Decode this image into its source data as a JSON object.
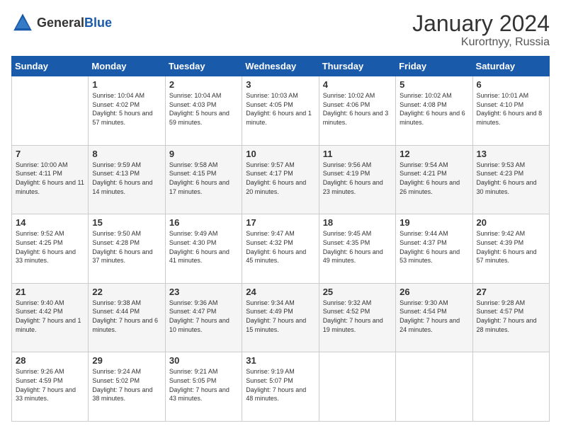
{
  "header": {
    "logo_general": "General",
    "logo_blue": "Blue",
    "month": "January 2024",
    "location": "Kurortnyy, Russia"
  },
  "weekdays": [
    "Sunday",
    "Monday",
    "Tuesday",
    "Wednesday",
    "Thursday",
    "Friday",
    "Saturday"
  ],
  "weeks": [
    [
      {
        "day": "",
        "sunrise": "",
        "sunset": "",
        "daylight": ""
      },
      {
        "day": "1",
        "sunrise": "Sunrise: 10:04 AM",
        "sunset": "Sunset: 4:02 PM",
        "daylight": "Daylight: 5 hours and 57 minutes."
      },
      {
        "day": "2",
        "sunrise": "Sunrise: 10:04 AM",
        "sunset": "Sunset: 4:03 PM",
        "daylight": "Daylight: 5 hours and 59 minutes."
      },
      {
        "day": "3",
        "sunrise": "Sunrise: 10:03 AM",
        "sunset": "Sunset: 4:05 PM",
        "daylight": "Daylight: 6 hours and 1 minute."
      },
      {
        "day": "4",
        "sunrise": "Sunrise: 10:02 AM",
        "sunset": "Sunset: 4:06 PM",
        "daylight": "Daylight: 6 hours and 3 minutes."
      },
      {
        "day": "5",
        "sunrise": "Sunrise: 10:02 AM",
        "sunset": "Sunset: 4:08 PM",
        "daylight": "Daylight: 6 hours and 6 minutes."
      },
      {
        "day": "6",
        "sunrise": "Sunrise: 10:01 AM",
        "sunset": "Sunset: 4:10 PM",
        "daylight": "Daylight: 6 hours and 8 minutes."
      }
    ],
    [
      {
        "day": "7",
        "sunrise": "Sunrise: 10:00 AM",
        "sunset": "Sunset: 4:11 PM",
        "daylight": "Daylight: 6 hours and 11 minutes."
      },
      {
        "day": "8",
        "sunrise": "Sunrise: 9:59 AM",
        "sunset": "Sunset: 4:13 PM",
        "daylight": "Daylight: 6 hours and 14 minutes."
      },
      {
        "day": "9",
        "sunrise": "Sunrise: 9:58 AM",
        "sunset": "Sunset: 4:15 PM",
        "daylight": "Daylight: 6 hours and 17 minutes."
      },
      {
        "day": "10",
        "sunrise": "Sunrise: 9:57 AM",
        "sunset": "Sunset: 4:17 PM",
        "daylight": "Daylight: 6 hours and 20 minutes."
      },
      {
        "day": "11",
        "sunrise": "Sunrise: 9:56 AM",
        "sunset": "Sunset: 4:19 PM",
        "daylight": "Daylight: 6 hours and 23 minutes."
      },
      {
        "day": "12",
        "sunrise": "Sunrise: 9:54 AM",
        "sunset": "Sunset: 4:21 PM",
        "daylight": "Daylight: 6 hours and 26 minutes."
      },
      {
        "day": "13",
        "sunrise": "Sunrise: 9:53 AM",
        "sunset": "Sunset: 4:23 PM",
        "daylight": "Daylight: 6 hours and 30 minutes."
      }
    ],
    [
      {
        "day": "14",
        "sunrise": "Sunrise: 9:52 AM",
        "sunset": "Sunset: 4:25 PM",
        "daylight": "Daylight: 6 hours and 33 minutes."
      },
      {
        "day": "15",
        "sunrise": "Sunrise: 9:50 AM",
        "sunset": "Sunset: 4:28 PM",
        "daylight": "Daylight: 6 hours and 37 minutes."
      },
      {
        "day": "16",
        "sunrise": "Sunrise: 9:49 AM",
        "sunset": "Sunset: 4:30 PM",
        "daylight": "Daylight: 6 hours and 41 minutes."
      },
      {
        "day": "17",
        "sunrise": "Sunrise: 9:47 AM",
        "sunset": "Sunset: 4:32 PM",
        "daylight": "Daylight: 6 hours and 45 minutes."
      },
      {
        "day": "18",
        "sunrise": "Sunrise: 9:45 AM",
        "sunset": "Sunset: 4:35 PM",
        "daylight": "Daylight: 6 hours and 49 minutes."
      },
      {
        "day": "19",
        "sunrise": "Sunrise: 9:44 AM",
        "sunset": "Sunset: 4:37 PM",
        "daylight": "Daylight: 6 hours and 53 minutes."
      },
      {
        "day": "20",
        "sunrise": "Sunrise: 9:42 AM",
        "sunset": "Sunset: 4:39 PM",
        "daylight": "Daylight: 6 hours and 57 minutes."
      }
    ],
    [
      {
        "day": "21",
        "sunrise": "Sunrise: 9:40 AM",
        "sunset": "Sunset: 4:42 PM",
        "daylight": "Daylight: 7 hours and 1 minute."
      },
      {
        "day": "22",
        "sunrise": "Sunrise: 9:38 AM",
        "sunset": "Sunset: 4:44 PM",
        "daylight": "Daylight: 7 hours and 6 minutes."
      },
      {
        "day": "23",
        "sunrise": "Sunrise: 9:36 AM",
        "sunset": "Sunset: 4:47 PM",
        "daylight": "Daylight: 7 hours and 10 minutes."
      },
      {
        "day": "24",
        "sunrise": "Sunrise: 9:34 AM",
        "sunset": "Sunset: 4:49 PM",
        "daylight": "Daylight: 7 hours and 15 minutes."
      },
      {
        "day": "25",
        "sunrise": "Sunrise: 9:32 AM",
        "sunset": "Sunset: 4:52 PM",
        "daylight": "Daylight: 7 hours and 19 minutes."
      },
      {
        "day": "26",
        "sunrise": "Sunrise: 9:30 AM",
        "sunset": "Sunset: 4:54 PM",
        "daylight": "Daylight: 7 hours and 24 minutes."
      },
      {
        "day": "27",
        "sunrise": "Sunrise: 9:28 AM",
        "sunset": "Sunset: 4:57 PM",
        "daylight": "Daylight: 7 hours and 28 minutes."
      }
    ],
    [
      {
        "day": "28",
        "sunrise": "Sunrise: 9:26 AM",
        "sunset": "Sunset: 4:59 PM",
        "daylight": "Daylight: 7 hours and 33 minutes."
      },
      {
        "day": "29",
        "sunrise": "Sunrise: 9:24 AM",
        "sunset": "Sunset: 5:02 PM",
        "daylight": "Daylight: 7 hours and 38 minutes."
      },
      {
        "day": "30",
        "sunrise": "Sunrise: 9:21 AM",
        "sunset": "Sunset: 5:05 PM",
        "daylight": "Daylight: 7 hours and 43 minutes."
      },
      {
        "day": "31",
        "sunrise": "Sunrise: 9:19 AM",
        "sunset": "Sunset: 5:07 PM",
        "daylight": "Daylight: 7 hours and 48 minutes."
      },
      {
        "day": "",
        "sunrise": "",
        "sunset": "",
        "daylight": ""
      },
      {
        "day": "",
        "sunrise": "",
        "sunset": "",
        "daylight": ""
      },
      {
        "day": "",
        "sunrise": "",
        "sunset": "",
        "daylight": ""
      }
    ]
  ]
}
